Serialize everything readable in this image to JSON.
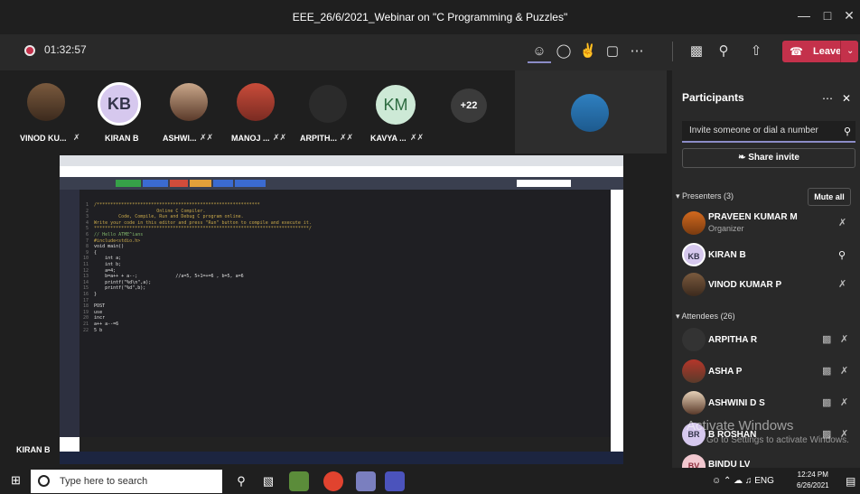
{
  "window": {
    "title": "EEE_26/6/2021_Webinar on \"C Programming & Puzzles\""
  },
  "meeting": {
    "timer": "01:32:57",
    "leave_label": "Leave"
  },
  "gallery": [
    {
      "name": "VINOD KU..."
    },
    {
      "name": "KIRAN B",
      "initials": "KB"
    },
    {
      "name": "ASHWI..."
    },
    {
      "name": "MANOJ ..."
    },
    {
      "name": "ARPITH..."
    },
    {
      "name": "KAVYA ...",
      "initials": "KM"
    }
  ],
  "overflow_count": "+22",
  "shared_screen": {
    "presenter": "KIRAN B"
  },
  "participants_panel": {
    "title": "Participants",
    "invite_placeholder": "Invite someone or dial a number",
    "share_invite": "Share invite",
    "presenters_header": "Presenters (3)",
    "mute_all": "Mute all",
    "presenters": [
      {
        "name": "PRAVEEN KUMAR M",
        "role": "Organizer"
      },
      {
        "name": "KIRAN B",
        "initials": "KB"
      },
      {
        "name": "VINOD KUMAR P"
      }
    ],
    "attendees_header": "Attendees (26)",
    "attendees": [
      {
        "name": "ARPITHA R"
      },
      {
        "name": "ASHA P"
      },
      {
        "name": "ASHWINI D S"
      },
      {
        "name": "B ROSHAN",
        "initials": "BR"
      },
      {
        "name": "BINDU LV",
        "initials": "BV"
      }
    ]
  },
  "watermark": {
    "line1": "Activate Windows",
    "line2": "Go to Settings to activate Windows."
  },
  "taskbar": {
    "search_placeholder": "Type here to search",
    "lang": "ENG",
    "time": "12:24 PM",
    "date": "6/26/2021"
  },
  "code_lines": [
    "/************************************************************",
    "                       Online C Compiler.",
    "         Code, Compile, Run and Debug C program online.",
    "Write your code in this editor and press \"Run\" button to compile and execute it.",
    "*******************************************************************************/",
    "// Hello ATME^ians",
    "#include<stdio.h>",
    "void main()",
    "{",
    "    int a;",
    "    int b;",
    "    a=4;",
    "    b=a++ + a--;              //a=5, 5+1=+=6 , b=5, a=6",
    "    printf(\"%d\\n\",a);",
    "    printf(\"%d\",b);",
    "}",
    "",
    "POST",
    "use",
    "incr",
    "a++ a--=6",
    "5 b"
  ],
  "colors": {
    "accent": "#6264a7",
    "leave": "#c4314b",
    "recording": "#c4314b"
  }
}
